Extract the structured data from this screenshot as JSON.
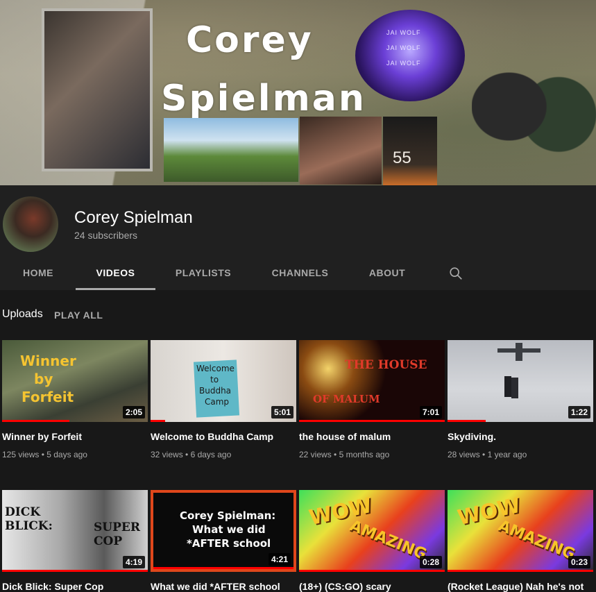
{
  "banner": {
    "title_line1": "Corey",
    "title_line2": "Spielman",
    "badge_lines": [
      "JAI WOLF",
      "JAI WOLF",
      "JAI WOLF"
    ],
    "photo_number": "55"
  },
  "channel": {
    "name": "Corey Spielman",
    "subscribers": "24 subscribers"
  },
  "tabs": [
    {
      "label": "HOME"
    },
    {
      "label": "VIDEOS"
    },
    {
      "label": "PLAYLISTS"
    },
    {
      "label": "CHANNELS"
    },
    {
      "label": "ABOUT"
    }
  ],
  "active_tab": "VIDEOS",
  "section": {
    "label": "Uploads",
    "play_all": "PLAY ALL"
  },
  "videos": [
    {
      "title": "Winner by Forfeit",
      "views": "125 views",
      "age": "5 days ago",
      "duration": "2:05",
      "thumb_text": [
        "Winner",
        "by",
        "Forfeit"
      ],
      "watched": 0.46
    },
    {
      "title": "Welcome to Buddha Camp",
      "views": "32 views",
      "age": "6 days ago",
      "duration": "5:01",
      "thumb_text": [
        "Welcome",
        "to",
        "Buddha",
        "Camp"
      ],
      "watched": 0.1
    },
    {
      "title": "the house of malum",
      "views": "22 views",
      "age": "5 months ago",
      "duration": "7:01",
      "thumb_text": [
        "THE HOUSE",
        "OF MALUM"
      ],
      "watched": 1.0
    },
    {
      "title": "Skydiving.",
      "views": "28 views",
      "age": "1 year ago",
      "duration": "1:22",
      "thumb_text": [],
      "watched": 0.26
    },
    {
      "title": "Dick Blick: Super Cop",
      "views": "",
      "age": "",
      "duration": "4:19",
      "thumb_text": [
        "DICK",
        "BLICK:",
        "SUPER",
        "COP"
      ],
      "watched": 1.0
    },
    {
      "title": "What we did *AFTER school",
      "views": "",
      "age": "",
      "duration": "4:21",
      "thumb_text": [
        "Corey Spielman:",
        "What we did",
        "*AFTER school"
      ],
      "watched": 1.0
    },
    {
      "title": "(18+) (CS:GO) scary",
      "views": "",
      "age": "",
      "duration": "0:28",
      "thumb_text": [
        "WOW",
        "AMAZING"
      ],
      "watched": 1.0
    },
    {
      "title": "(Rocket League) Nah he's not",
      "views": "",
      "age": "",
      "duration": "0:23",
      "thumb_text": [
        "WOW",
        "AMAZING"
      ],
      "watched": 1.0
    }
  ],
  "colors": {
    "background": "#181818",
    "header": "#202020",
    "progress": "#ff0000",
    "muted_text": "#aaaaaa"
  }
}
